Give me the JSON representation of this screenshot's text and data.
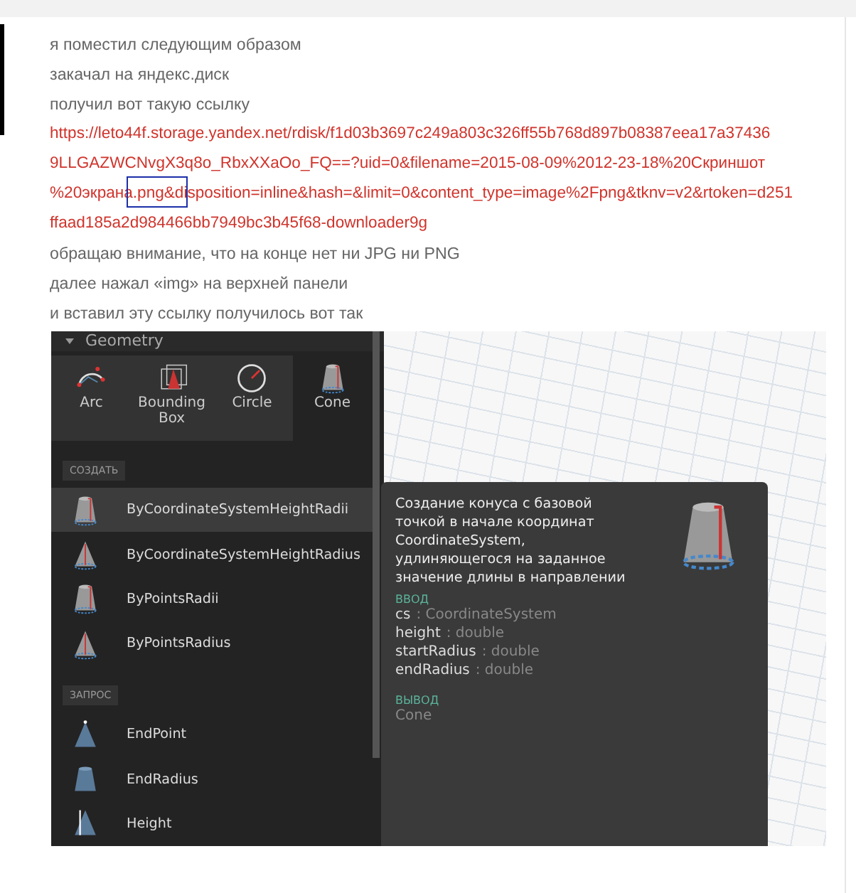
{
  "post": {
    "lines": [
      {
        "kind": "text",
        "text": "я поместил следующим образом"
      },
      {
        "kind": "text",
        "text": "закачал на яндекс.диск"
      },
      {
        "kind": "text",
        "text": "получил вот такую ссылку"
      },
      {
        "kind": "link",
        "text": "https://leto44f.storage.yandex.net/rdisk/f1d03b3697c249a803c326ff55b768d897b08387eea17a37436"
      },
      {
        "kind": "link",
        "text": "9LLGAZWCNvgX3q8o_RbxXXaOo_FQ==?uid=0&filename=2015-08-09%2012-23-18%20Скриншот"
      },
      {
        "kind": "link",
        "text": "%20экрана.png&disposition=inline&hash=&limit=0&content_type=image%2Fpng&tknv=v2&rtoken=d251"
      },
      {
        "kind": "link",
        "text": "ffaad185a2d984466bb7949bc3b45f68-downloader9g"
      },
      {
        "kind": "text",
        "text": "обращаю внимание, что на конце нет ни JPG ни PNG"
      },
      {
        "kind": "text",
        "text": "далее нажал «img» на верхней панели"
      },
      {
        "kind": "text",
        "text": "и вставил эту ссылку получилось вот так"
      }
    ]
  },
  "library": {
    "header": "Geometry",
    "categories": [
      {
        "label": "Arc",
        "kind": "arc",
        "selected": false
      },
      {
        "label": "Bounding Box",
        "kind": "box",
        "selected": false
      },
      {
        "label": "Circle",
        "kind": "circle",
        "selected": false
      },
      {
        "label": "Cone",
        "kind": "frustum",
        "selected": true
      }
    ],
    "sections": [
      {
        "label": "СОЗДАТЬ",
        "items": [
          {
            "label": "ByCoordinateSystemHeightRadii",
            "kind": "frustum",
            "selected": true
          },
          {
            "label": "ByCoordinateSystemHeightRadius",
            "kind": "cone",
            "selected": false
          },
          {
            "label": "ByPointsRadii",
            "kind": "frustum",
            "selected": false
          },
          {
            "label": "ByPointsRadius",
            "kind": "cone",
            "selected": false
          }
        ]
      },
      {
        "label": "ЗАПРОС",
        "items": [
          {
            "label": "EndPoint",
            "kind": "cone-blue",
            "selected": false
          },
          {
            "label": "EndRadius",
            "kind": "frustum-blue",
            "selected": false
          },
          {
            "label": "Height",
            "kind": "cone-height",
            "selected": false
          }
        ]
      }
    ]
  },
  "tooltip": {
    "description": "Создание конуса с базовой\nточкой в начале координат\nCoordinateSystem,\nудлиняющегося на заданное\nзначение длины в направлении",
    "inputs_label": "ВВОД",
    "inputs": [
      {
        "name": "cs",
        "type": ": CoordinateSystem"
      },
      {
        "name": "height",
        "type": ": double"
      },
      {
        "name": "startRadius",
        "type": ": double"
      },
      {
        "name": "endRadius",
        "type": ": double"
      }
    ],
    "output_label": "ВЫВОД",
    "output": "Cone"
  }
}
